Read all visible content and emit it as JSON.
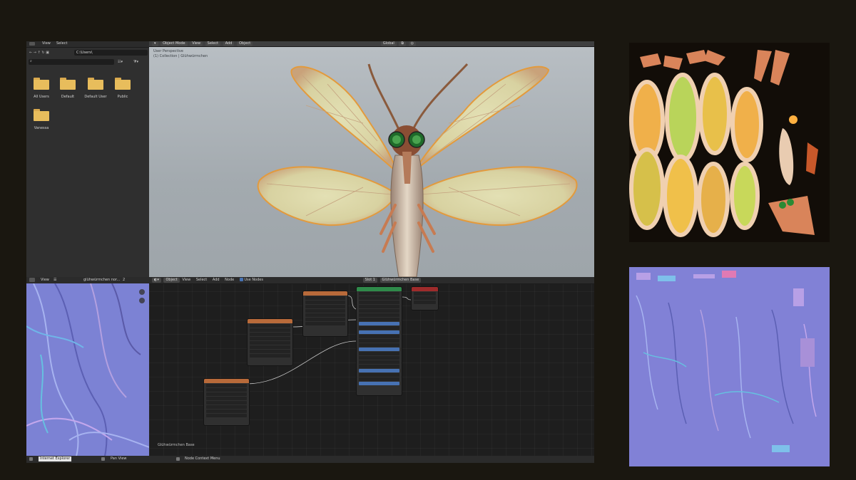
{
  "file_browser": {
    "menu": [
      "View",
      "Select"
    ],
    "path": "C:\\Users\\",
    "folders": [
      "All Users",
      "Default",
      "Default User",
      "Public",
      "Vanessa"
    ]
  },
  "viewport": {
    "mode": "Object Mode",
    "menu": [
      "View",
      "Select",
      "Add",
      "Object"
    ],
    "transform": "Global",
    "overlay_title": "User Perspective",
    "overlay_collection": "(1) Collection | Glühwürmchen"
  },
  "image_editor": {
    "view_label": "View",
    "image_name": "glühwürmchen nor...",
    "slot_number": "2"
  },
  "node_editor": {
    "mode": "Object",
    "menu": [
      "View",
      "Select",
      "Add",
      "Node"
    ],
    "use_nodes": "Use Nodes",
    "slot": "Slot 1",
    "material": "Glühwürmchen Base",
    "footer_label": "Glühwürmchen Base"
  },
  "status_bar": {
    "tooltip": "Internet Explorer",
    "pan": "Pan View",
    "context": "Node Context Menu"
  },
  "colors": {
    "app_bg": "#1a1710",
    "folder": "#e8bd5c",
    "bsdf_header": "#2f8a4a",
    "texture_header": "#b86a3a",
    "output_header": "#9e2b2b",
    "normal_map_bg": "#8181d6"
  }
}
